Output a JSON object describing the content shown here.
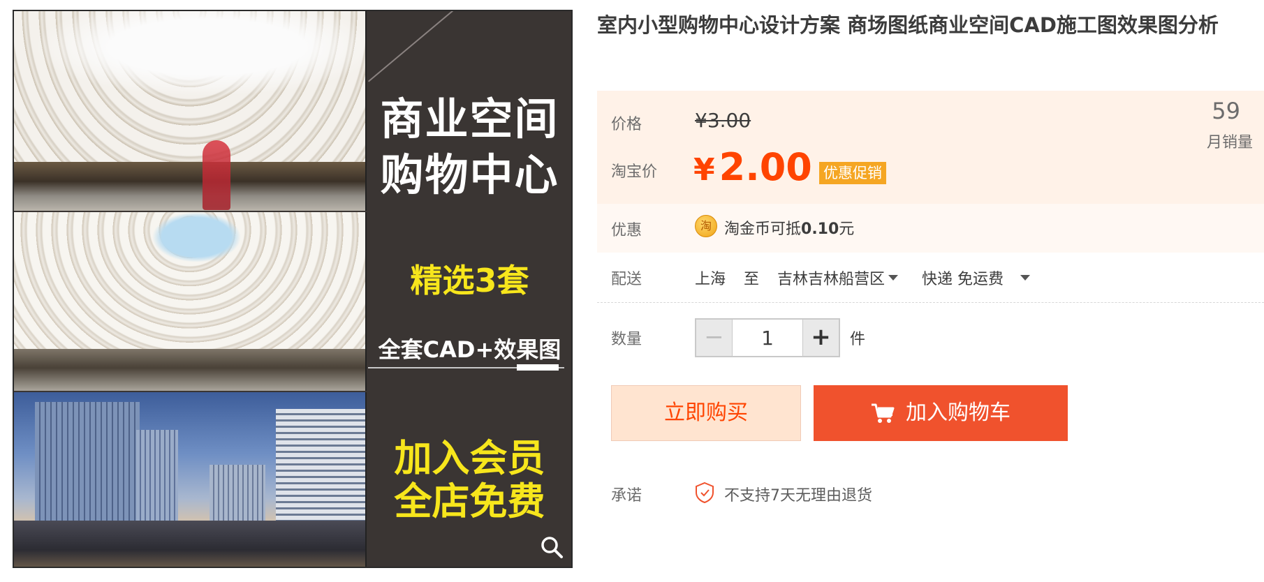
{
  "product": {
    "title": "室内小型购物中心设计方案 商场图纸商业空间CAD施工图效果图分析"
  },
  "gallery": {
    "promo_line1": "商业空间",
    "promo_line2": "购物中心",
    "promo_sets": "精选3套",
    "promo_cad": "全套CAD+效果图",
    "promo_member1": "加入会员",
    "promo_member2": "全店免费"
  },
  "price": {
    "label": "价格",
    "original": "¥3.00",
    "tb_label": "淘宝价",
    "currency": "¥",
    "tb_price": "2.00",
    "promo_tag": "优惠促销",
    "sales_count": "59",
    "sales_label": "月销量"
  },
  "coupon": {
    "label": "优惠",
    "coin_glyph": "淘",
    "text_prefix": "淘金币可抵",
    "amount": "0.10",
    "text_suffix": "元"
  },
  "shipping": {
    "label": "配送",
    "from": "上海",
    "to_word": "至",
    "destination": "吉林吉林船营区",
    "method": "快递 免运费"
  },
  "quantity": {
    "label": "数量",
    "value": "1",
    "unit": "件"
  },
  "actions": {
    "buy_now": "立即购买",
    "add_to_cart": "加入购物车"
  },
  "promise": {
    "label": "承诺",
    "text": "不支持7天无理由退货"
  },
  "colors": {
    "accent": "#ff4400",
    "cart_button": "#f0522d",
    "buy_button_bg": "#ffe4d0",
    "price_box_bg": "#fff2e8",
    "promo_tag_bg": "#f5a623",
    "promo_yellow": "#f7e61c"
  },
  "icons": [
    "search-icon",
    "coin-icon",
    "cart-icon",
    "shield-check-icon",
    "caret-down-icon"
  ]
}
